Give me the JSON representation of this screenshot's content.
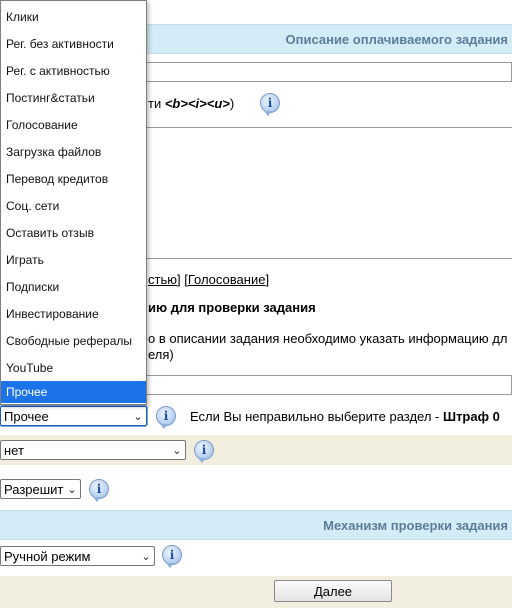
{
  "section_headers": {
    "description": "Описание оплачиваемого задания",
    "mechanism": "Механизм проверки задания"
  },
  "formatting_hint": {
    "prefix": "ти ",
    "tags": "<b><i><u>",
    "suffix": ")"
  },
  "tag_links": {
    "bracket_open": "[",
    "partial_link": "стью",
    "separator": "] [",
    "voting_link": "Голосование",
    "bracket_close": "]"
  },
  "verification": {
    "heading": "ию для проверки задания",
    "text_line1": "о в описании задания необходимо указать информацию дл",
    "text_line2": "еля)"
  },
  "category_select": {
    "value": "Прочее",
    "warning_text": "Если Вы неправильно выберите раздел - ",
    "warning_bold": "Штраф 0"
  },
  "dropdown": {
    "options": [
      "Клики",
      "Рег. без активности",
      "Рег. с активностью",
      "Постинг&статьи",
      "Голосование",
      "Загрузка файлов",
      "Перевод кредитов",
      "Соц. сети",
      "Оставить отзыв",
      "Играть",
      "Подписки",
      "Инвестирование",
      "Свободные рефералы",
      "YouTube",
      "Прочее"
    ],
    "selected": "Прочее"
  },
  "yes_no_select": {
    "value": "нет"
  },
  "allow_select": {
    "value": "Разрешить"
  },
  "mode_select": {
    "value": "Ручной режим"
  },
  "next_button": {
    "label": "Далее"
  },
  "icons": {
    "info": "info-icon",
    "dropdown_arrow": "chevron-down-icon"
  },
  "colors": {
    "header_bg": "#d4ecf7",
    "header_text": "#5c7d99",
    "row_beige": "#f1eedf",
    "dropdown_highlight": "#1a73e8"
  }
}
